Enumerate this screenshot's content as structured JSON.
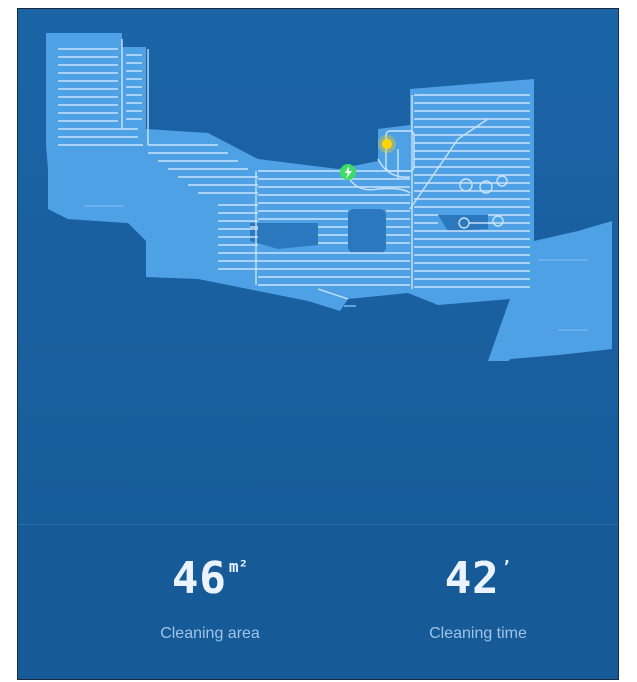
{
  "map": {
    "robot_color": "#ffd400",
    "dock_color": "#3ddc64",
    "floor_color": "#4fa1e6",
    "path_color": "#d7ebff",
    "dock_icon": "lightning-bolt-icon"
  },
  "stats": {
    "area": {
      "value": "46",
      "unit": "m²",
      "label": "Cleaning area"
    },
    "time": {
      "value": "42",
      "unit": "’",
      "label": "Cleaning time"
    }
  }
}
